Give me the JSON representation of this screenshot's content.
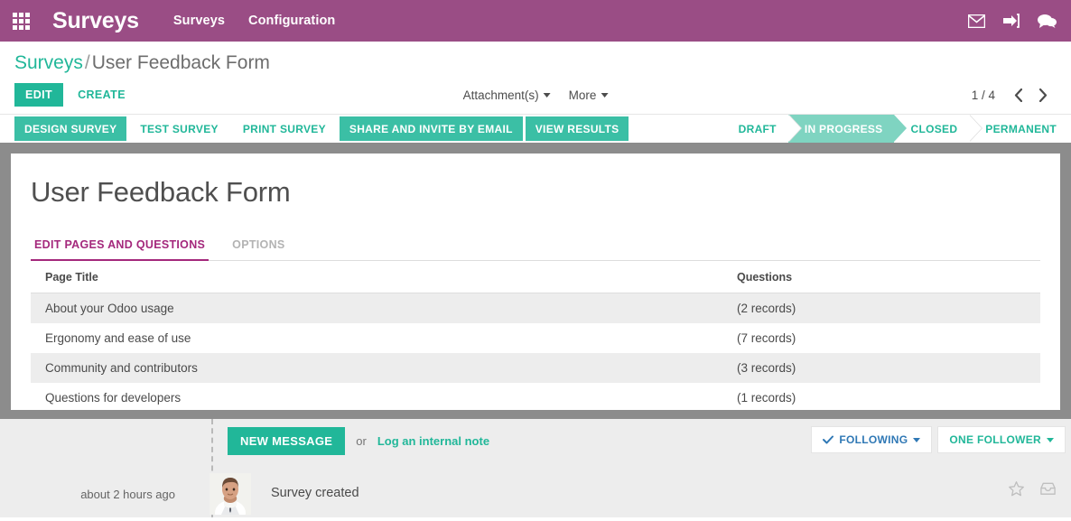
{
  "navbar": {
    "apps_icon": "apps-grid-icon",
    "brand": "Surveys",
    "menu": [
      {
        "label": "Surveys"
      },
      {
        "label": "Configuration"
      }
    ],
    "icons": [
      {
        "name": "mail-icon"
      },
      {
        "name": "sign-in-icon"
      },
      {
        "name": "conversations-icon"
      }
    ],
    "background_color": "#9a4d85"
  },
  "breadcrumb": {
    "root": "Surveys",
    "separator": "/",
    "current": "User Feedback Form"
  },
  "control_panel": {
    "edit_label": "EDIT",
    "create_label": "CREATE",
    "attachments_label": "Attachment(s)",
    "more_label": "More",
    "pager_value": "1 / 4",
    "prev_label": "previous-record",
    "next_label": "next-record"
  },
  "button_bar": [
    {
      "label": "DESIGN SURVEY",
      "style": "filled"
    },
    {
      "label": "TEST SURVEY",
      "style": "ghost"
    },
    {
      "label": "PRINT SURVEY",
      "style": "ghost"
    },
    {
      "label": "SHARE AND INVITE BY EMAIL",
      "style": "filled"
    },
    {
      "label": "VIEW RESULTS",
      "style": "filled"
    }
  ],
  "statusbar": {
    "states": [
      {
        "label": "DRAFT",
        "active": false
      },
      {
        "label": "IN PROGRESS",
        "active": true
      },
      {
        "label": "CLOSED",
        "active": false
      },
      {
        "label": "PERMANENT",
        "active": false
      }
    ],
    "active_color": "#7fd4c1",
    "text_color": "#21b799"
  },
  "form": {
    "title": "User Feedback Form",
    "tabs": [
      {
        "label": "EDIT PAGES AND QUESTIONS",
        "active": true
      },
      {
        "label": "OPTIONS",
        "active": false
      }
    ],
    "active_tab_color": "#a4287c",
    "table": {
      "columns": [
        "Page Title",
        "Questions"
      ],
      "rows": [
        {
          "page_title": "About your Odoo usage",
          "questions": "(2 records)"
        },
        {
          "page_title": "Ergonomy and ease of use",
          "questions": "(7 records)"
        },
        {
          "page_title": "Community and contributors",
          "questions": "(3 records)"
        },
        {
          "page_title": "Questions for developers",
          "questions": "(1 records)"
        }
      ]
    }
  },
  "chatter": {
    "new_message_label": "NEW MESSAGE",
    "or_label": "or",
    "log_note_label": "Log an internal note",
    "following_label": "FOLLOWING",
    "followers_label": "ONE FOLLOWER",
    "messages": [
      {
        "time": "about 2 hours ago",
        "text": "Survey created",
        "avatar": "user-avatar"
      }
    ],
    "star_icon": "star-icon",
    "inbox_icon": "inbox-icon"
  },
  "colors": {
    "primary_teal": "#21b799",
    "button_teal": "#3bbfa5",
    "brand_purple": "#9a4d85",
    "accent_magenta": "#a4287c",
    "frame_gray": "#8c8c8c",
    "chatter_bg": "#ededed"
  }
}
